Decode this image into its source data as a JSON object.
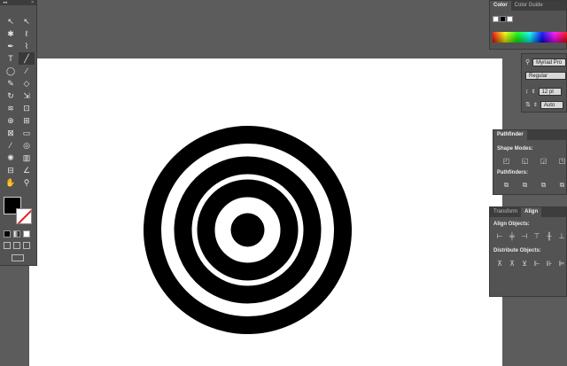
{
  "tools_panel": {
    "header_left": "◂◂",
    "header_right": "×",
    "tools": [
      {
        "name": "selection-tool-icon",
        "glyph": "↖"
      },
      {
        "name": "direct-selection-tool-icon",
        "glyph": "↖"
      },
      {
        "name": "magic-wand-tool-icon",
        "glyph": "✱"
      },
      {
        "name": "lasso-tool-icon",
        "glyph": "ℓ"
      },
      {
        "name": "pen-tool-icon",
        "glyph": "✒"
      },
      {
        "name": "curvature-tool-icon",
        "glyph": "⌇"
      },
      {
        "name": "type-tool-icon",
        "glyph": "T"
      },
      {
        "name": "line-segment-tool-icon",
        "glyph": "╱"
      },
      {
        "name": "ellipse-tool-icon",
        "glyph": "◯"
      },
      {
        "name": "paintbrush-tool-icon",
        "glyph": "∕"
      },
      {
        "name": "pencil-tool-icon",
        "glyph": "✎"
      },
      {
        "name": "eraser-tool-icon",
        "glyph": "◇"
      },
      {
        "name": "rotate-tool-icon",
        "glyph": "↻"
      },
      {
        "name": "scale-tool-icon",
        "glyph": "⇲"
      },
      {
        "name": "warp-tool-icon",
        "glyph": "≋"
      },
      {
        "name": "free-transform-tool-icon",
        "glyph": "⊡"
      },
      {
        "name": "shape-builder-tool-icon",
        "glyph": "⊕"
      },
      {
        "name": "perspective-grid-tool-icon",
        "glyph": "⊞"
      },
      {
        "name": "mesh-tool-icon",
        "glyph": "⊠"
      },
      {
        "name": "gradient-tool-icon",
        "glyph": "▭"
      },
      {
        "name": "eyedropper-tool-icon",
        "glyph": "⁄"
      },
      {
        "name": "blend-tool-icon",
        "glyph": "◎"
      },
      {
        "name": "symbol-sprayer-tool-icon",
        "glyph": "✺"
      },
      {
        "name": "column-graph-tool-icon",
        "glyph": "▥"
      },
      {
        "name": "artboard-tool-icon",
        "glyph": "⊟"
      },
      {
        "name": "slice-tool-icon",
        "glyph": "∠"
      },
      {
        "name": "hand-tool-icon",
        "glyph": "✋"
      },
      {
        "name": "zoom-tool-icon",
        "glyph": "⚲"
      }
    ]
  },
  "color_panel": {
    "tabs": [
      "Color",
      "Color Guide"
    ],
    "menu_glyph": "≡"
  },
  "character_panel": {
    "font_family": "Myriad Pro",
    "font_style": "Regular",
    "font_size": "12 pt",
    "leading": "Auto"
  },
  "pathfinder_panel": {
    "tabs": [
      "Pathfinder"
    ],
    "shape_modes_label": "Shape Modes:",
    "pathfinders_label": "Pathfinders:"
  },
  "align_panel": {
    "tabs": [
      "Transform",
      "Align"
    ],
    "align_objects_label": "Align Objects:",
    "distribute_objects_label": "Distribute Objects:"
  },
  "colors": {
    "workspace": "#5c5c5c",
    "panel": "#535353",
    "artboard": "#ffffff",
    "ink": "#000000"
  }
}
